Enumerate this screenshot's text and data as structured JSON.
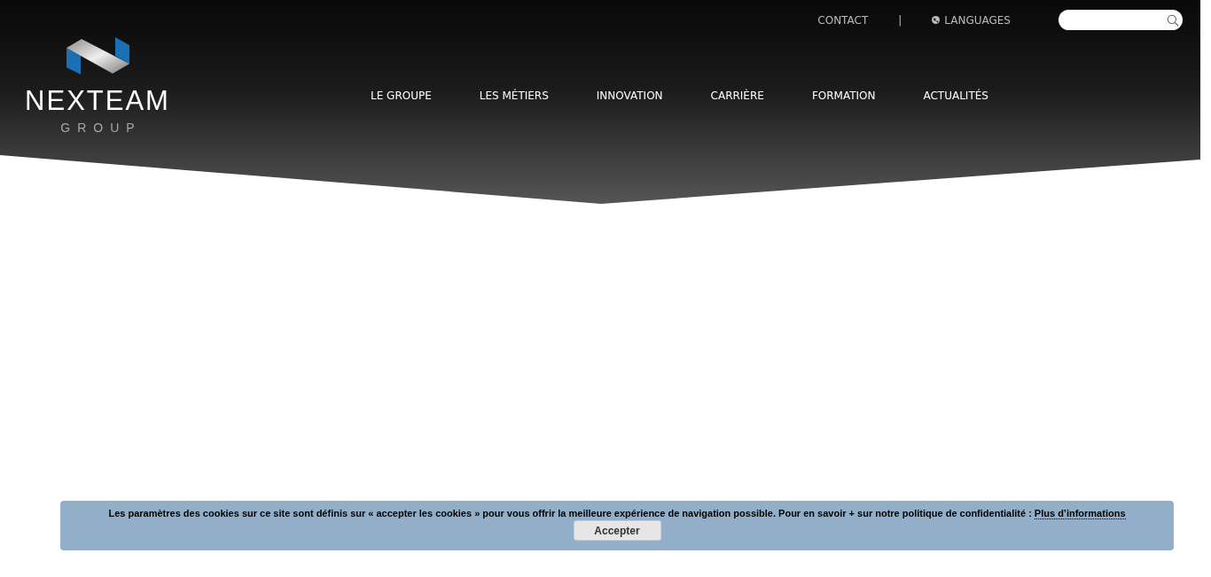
{
  "logo": {
    "name": "NEXTEAM",
    "tagline": "GROUP"
  },
  "top_links": [
    {
      "kind": "link",
      "label": "CONTACT"
    },
    {
      "kind": "separator",
      "label": "|"
    },
    {
      "kind": "languages",
      "label": "LANGUAGES"
    }
  ],
  "nav": [
    {
      "label": "LE GROUPE"
    },
    {
      "label": "LES MÉTIERS"
    },
    {
      "label": "INNOVATION"
    },
    {
      "label": "CARRIÈRE"
    },
    {
      "label": "FORMATION"
    },
    {
      "label": "ACTUALITÉS"
    }
  ],
  "cookie_banner": {
    "text": "Les paramètres des cookies sur ce site sont définis sur « accepter les cookies » pour vous offrir la meilleure expérience de navigation possible. Pour en savoir + sur notre politique de confidentialité :",
    "link": "Plus d’informations",
    "button": "Accepter"
  }
}
